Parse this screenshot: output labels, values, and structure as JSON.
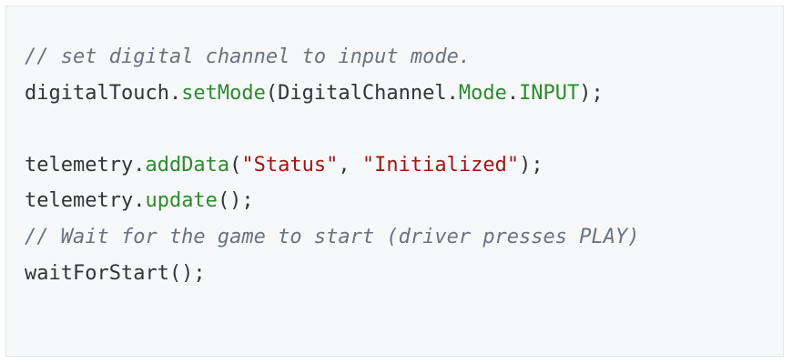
{
  "code": {
    "lines": [
      {
        "tokens": [
          {
            "text": "// set digital channel to input mode.",
            "kind": "comment"
          }
        ]
      },
      {
        "tokens": [
          {
            "text": "digitalTouch.",
            "kind": "plain"
          },
          {
            "text": "setMode",
            "kind": "function"
          },
          {
            "text": "(DigitalChannel.",
            "kind": "plain"
          },
          {
            "text": "Mode",
            "kind": "function"
          },
          {
            "text": ".",
            "kind": "plain"
          },
          {
            "text": "INPUT",
            "kind": "function"
          },
          {
            "text": ");",
            "kind": "plain"
          }
        ]
      },
      {
        "tokens": []
      },
      {
        "tokens": [
          {
            "text": "telemetry.",
            "kind": "plain"
          },
          {
            "text": "addData",
            "kind": "function"
          },
          {
            "text": "(",
            "kind": "plain"
          },
          {
            "text": "\"Status\"",
            "kind": "string"
          },
          {
            "text": ", ",
            "kind": "plain"
          },
          {
            "text": "\"Initialized\"",
            "kind": "string"
          },
          {
            "text": ");",
            "kind": "plain"
          }
        ]
      },
      {
        "tokens": [
          {
            "text": "telemetry.",
            "kind": "plain"
          },
          {
            "text": "update",
            "kind": "function"
          },
          {
            "text": "();",
            "kind": "plain"
          }
        ]
      },
      {
        "tokens": [
          {
            "text": "// Wait for the game to start (driver presses PLAY)",
            "kind": "comment"
          }
        ]
      },
      {
        "tokens": [
          {
            "text": "waitForStart();",
            "kind": "plain"
          }
        ]
      }
    ]
  },
  "colors": {
    "background": "#f6f8fa",
    "comment": "#6a737d",
    "function": "#2f8a2f",
    "string": "#a31515",
    "plain": "#333333"
  }
}
